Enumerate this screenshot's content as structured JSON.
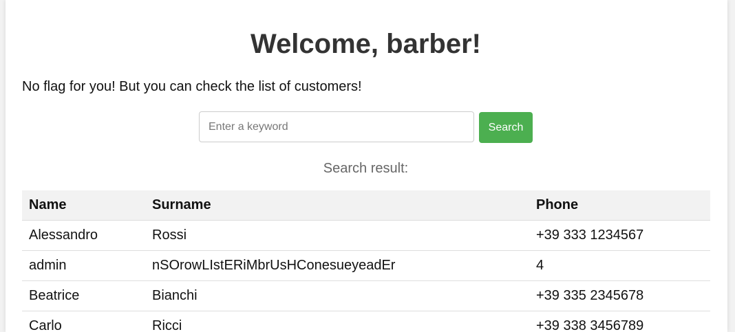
{
  "header": {
    "title": "Welcome, barber!",
    "subtitle": "No flag for you! But you can check the list of customers!"
  },
  "search": {
    "placeholder": "Enter a keyword",
    "value": "",
    "button_label": "Search",
    "result_label": "Search result:"
  },
  "table": {
    "columns": [
      "Name",
      "Surname",
      "Phone"
    ],
    "rows": [
      {
        "name": "Alessandro",
        "surname": "Rossi",
        "phone": "+39 333 1234567"
      },
      {
        "name": "admin",
        "surname": "nSOrowLIstERiMbrUsHConesueyeadEr",
        "phone": "4"
      },
      {
        "name": "Beatrice",
        "surname": "Bianchi",
        "phone": "+39 335 2345678"
      },
      {
        "name": "Carlo",
        "surname": "Ricci",
        "phone": "+39 338 3456789"
      }
    ]
  },
  "colors": {
    "accent": "#4caf50",
    "header_bg": "#f2f2f2",
    "title_text": "#333333"
  }
}
